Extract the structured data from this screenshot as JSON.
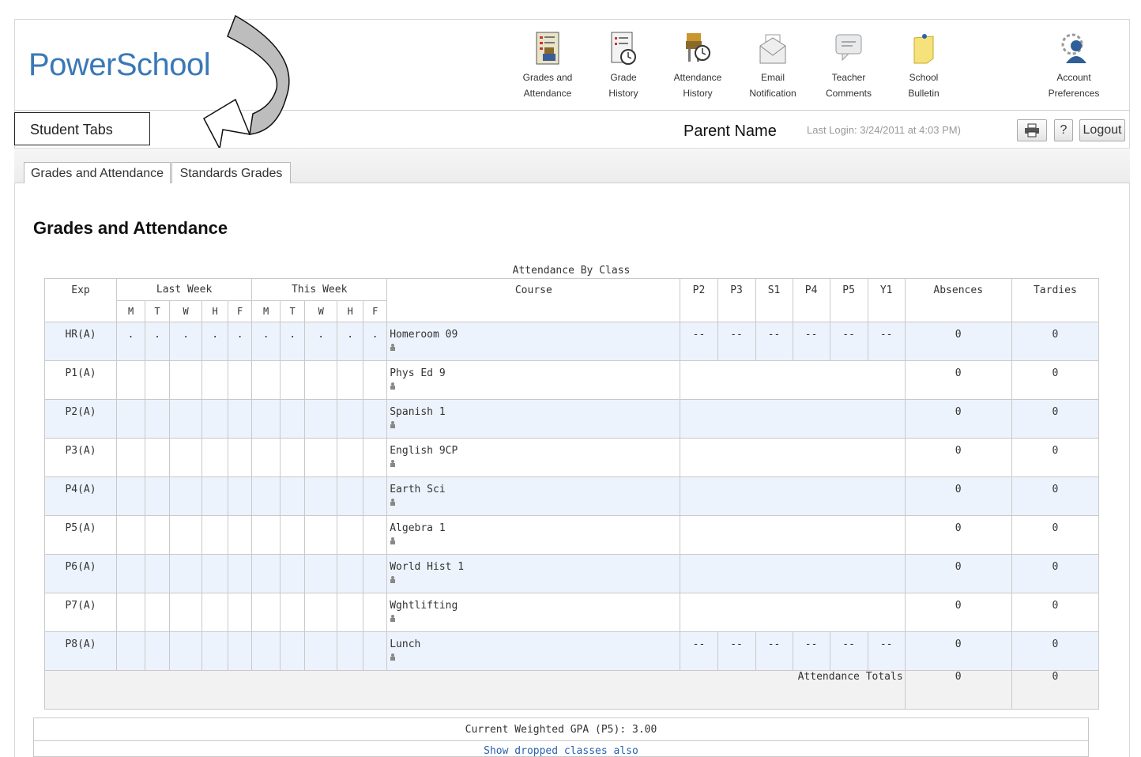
{
  "app": {
    "logo": "PowerSchool"
  },
  "nav": [
    {
      "name": "grades-attendance",
      "line1": "Grades and",
      "line2": "Attendance",
      "icon": "grades-attendance-icon"
    },
    {
      "name": "grade-history",
      "line1": "Grade",
      "line2": "History",
      "icon": "grade-history-icon"
    },
    {
      "name": "attendance-history",
      "line1": "Attendance",
      "line2": "History",
      "icon": "attendance-history-icon"
    },
    {
      "name": "email-notification",
      "line1": "Email",
      "line2": "Notification",
      "icon": "envelope-icon"
    },
    {
      "name": "teacher-comments",
      "line1": "Teacher",
      "line2": "Comments",
      "icon": "speech-bubble-icon"
    },
    {
      "name": "school-bulletin",
      "line1": "School",
      "line2": "Bulletin",
      "icon": "sticky-note-icon"
    },
    {
      "name": "account-preferences",
      "line1": "Account",
      "line2": "Preferences",
      "icon": "user-gear-icon"
    }
  ],
  "annotations": {
    "student_tabs": "Student Tabs",
    "parent_name": "Parent Name"
  },
  "header": {
    "last_login": "Last Login: 3/24/2011 at 4:03 PM)",
    "print_icon": "printer-icon",
    "help_label": "?",
    "logout_label": "Logout"
  },
  "tabs": [
    {
      "label": "Grades and Attendance",
      "active": true
    },
    {
      "label": "Standards Grades",
      "active": false
    }
  ],
  "page_title": "Grades and Attendance",
  "table": {
    "caption": "Attendance By Class",
    "headers": {
      "exp": "Exp",
      "last_week": "Last Week",
      "this_week": "This Week",
      "course": "Course",
      "terms": [
        "P2",
        "P3",
        "S1",
        "P4",
        "P5",
        "Y1"
      ],
      "absences": "Absences",
      "tardies": "Tardies"
    },
    "days": [
      "M",
      "T",
      "W",
      "H",
      "F"
    ],
    "rows": [
      {
        "exp": "HR(A)",
        "days": [
          ".",
          ".",
          ".",
          ".",
          ".",
          ".",
          ".",
          ".",
          ".",
          "."
        ],
        "course": "Homeroom 09",
        "grades": [
          "--",
          "--",
          "--",
          "--",
          "--",
          "--"
        ],
        "absences": "0",
        "tardies": "0"
      },
      {
        "exp": "P1(A)",
        "days": [
          "",
          "",
          "",
          "",
          "",
          "",
          "",
          "",
          "",
          ""
        ],
        "course": "Phys Ed 9",
        "grades": null,
        "absences": "0",
        "tardies": "0"
      },
      {
        "exp": "P2(A)",
        "days": [
          "",
          "",
          "",
          "",
          "",
          "",
          "",
          "",
          "",
          ""
        ],
        "course": "Spanish 1",
        "grades": null,
        "absences": "0",
        "tardies": "0"
      },
      {
        "exp": "P3(A)",
        "days": [
          "",
          "",
          "",
          "",
          "",
          "",
          "",
          "",
          "",
          ""
        ],
        "course": "English 9CP",
        "grades": null,
        "absences": "0",
        "tardies": "0"
      },
      {
        "exp": "P4(A)",
        "days": [
          "",
          "",
          "",
          "",
          "",
          "",
          "",
          "",
          "",
          ""
        ],
        "course": "Earth Sci",
        "grades": null,
        "absences": "0",
        "tardies": "0"
      },
      {
        "exp": "P5(A)",
        "days": [
          "",
          "",
          "",
          "",
          "",
          "",
          "",
          "",
          "",
          ""
        ],
        "course": "Algebra 1",
        "grades": null,
        "absences": "0",
        "tardies": "0"
      },
      {
        "exp": "P6(A)",
        "days": [
          "",
          "",
          "",
          "",
          "",
          "",
          "",
          "",
          "",
          ""
        ],
        "course": "World Hist 1",
        "grades": null,
        "absences": "0",
        "tardies": "0"
      },
      {
        "exp": "P7(A)",
        "days": [
          "",
          "",
          "",
          "",
          "",
          "",
          "",
          "",
          "",
          ""
        ],
        "course": "Wghtlifting",
        "grades": null,
        "absences": "0",
        "tardies": "0"
      },
      {
        "exp": "P8(A)",
        "days": [
          "",
          "",
          "",
          "",
          "",
          "",
          "",
          "",
          "",
          ""
        ],
        "course": "Lunch",
        "grades": [
          "--",
          "--",
          "--",
          "--",
          "--",
          "--"
        ],
        "absences": "0",
        "tardies": "0"
      }
    ],
    "totals": {
      "label": "Attendance Totals",
      "absences": "0",
      "tardies": "0"
    }
  },
  "gpa": {
    "text": "Current Weighted GPA (P5): 3.00",
    "dropped_link": "Show dropped classes also"
  },
  "colors": {
    "logo": "#3a78b8",
    "row_alt": "#edf3fc",
    "link": "#2a62b0"
  }
}
